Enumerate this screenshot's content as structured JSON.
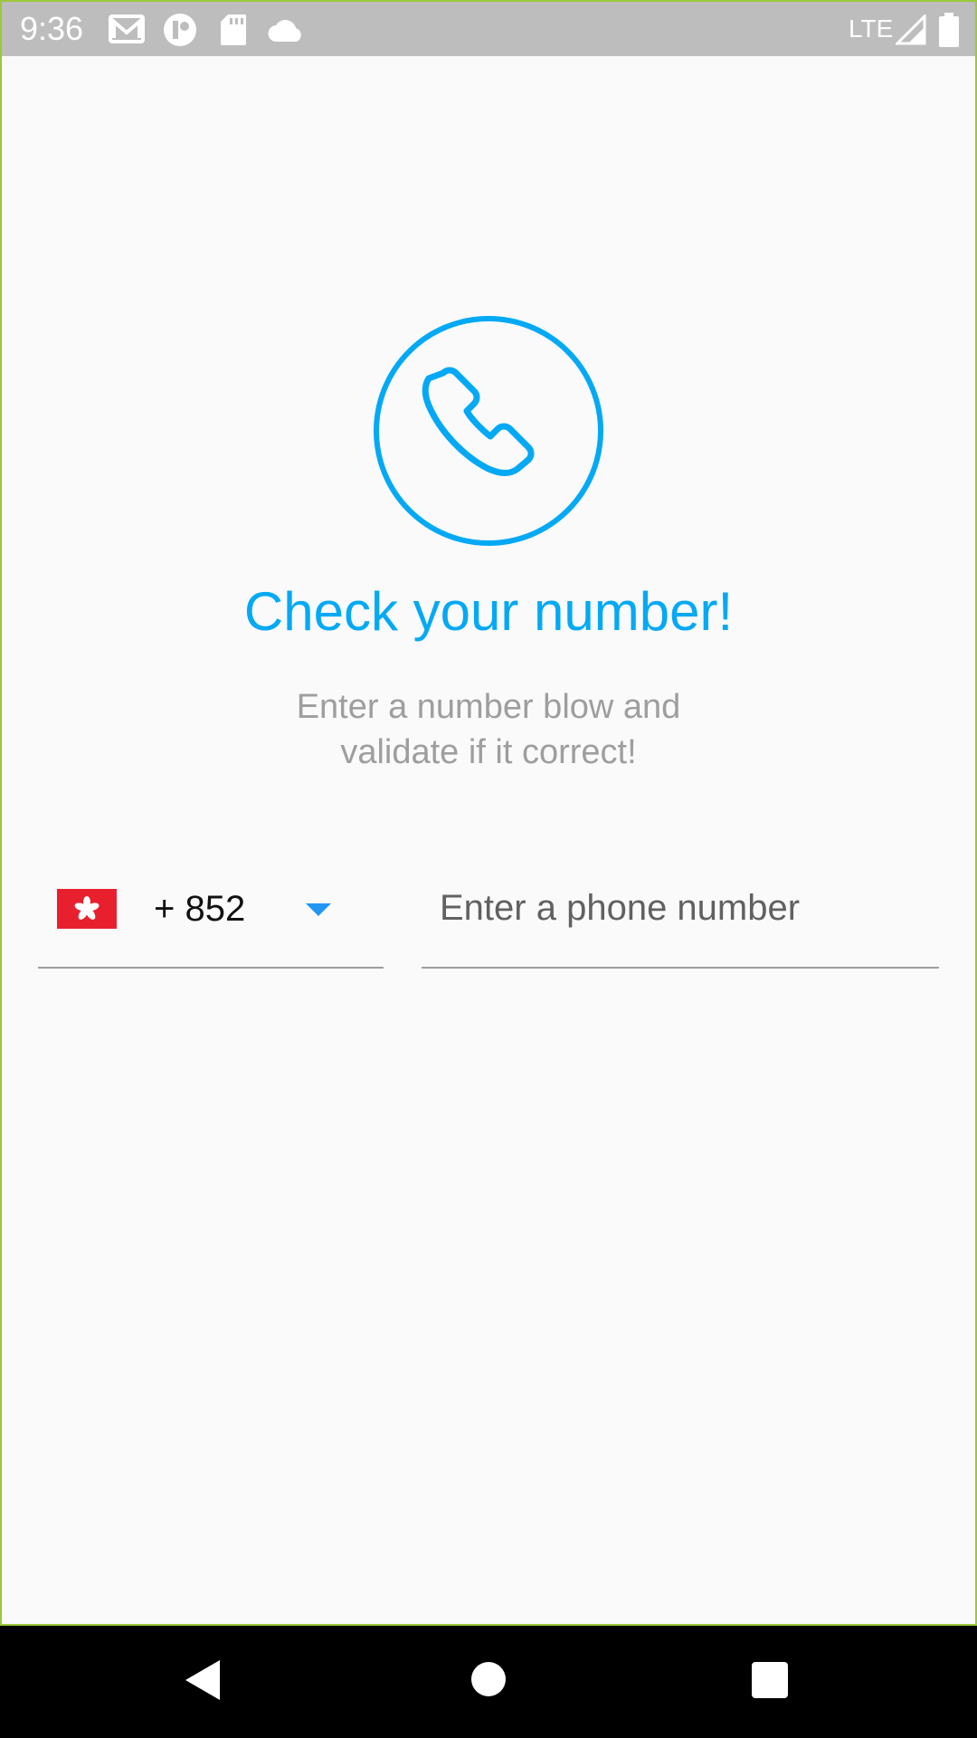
{
  "status_bar": {
    "time": "9:36",
    "network": "LTE",
    "icons": [
      "gmail-icon",
      "app-circle-icon",
      "sd-card-icon",
      "cloud-icon",
      "signal-icon",
      "battery-icon"
    ]
  },
  "main": {
    "icon": "phone-icon",
    "title": "Check your number!",
    "subtitle_line1": "Enter a number blow and",
    "subtitle_line2": "validate if it correct!",
    "country_flag": "hong-kong-flag-icon",
    "dial_code": "+ 852",
    "phone_placeholder": "Enter a phone number",
    "phone_value": ""
  },
  "nav_bar": {
    "icons": [
      "back-icon",
      "home-icon",
      "recents-icon"
    ]
  },
  "colors": {
    "accent": "#03a9f4",
    "dropdown": "#2196f3",
    "status_bar": "#bdbdbd",
    "flag_red": "#e8202e"
  }
}
